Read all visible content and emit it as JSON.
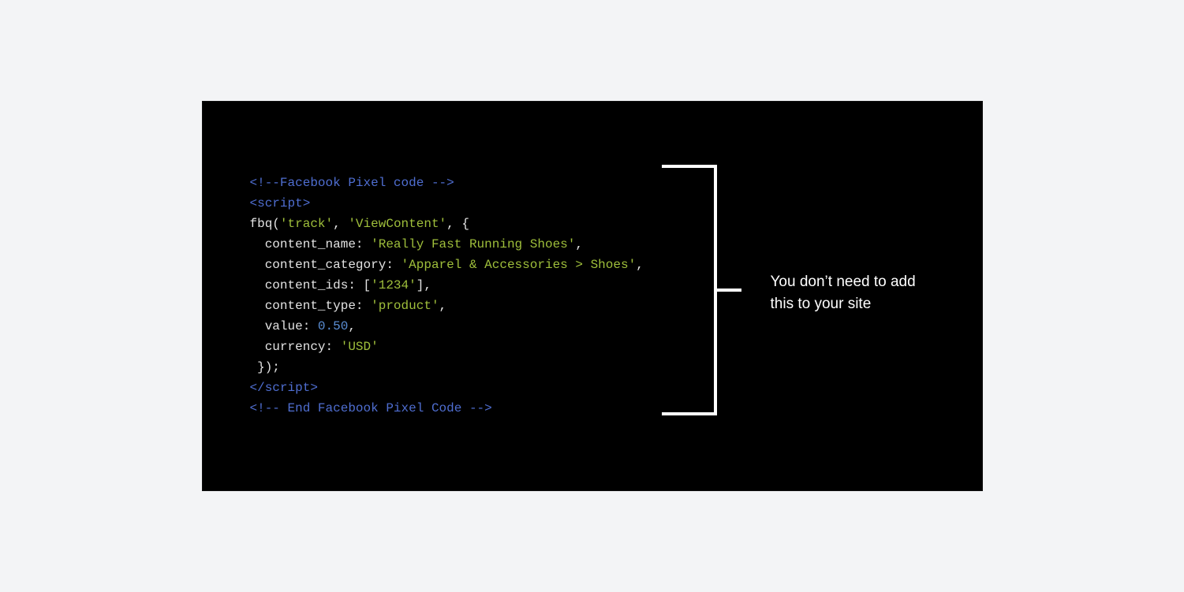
{
  "code": {
    "line1": "<!--Facebook Pixel code -->",
    "line2": "<script>",
    "l3a": "fbq(",
    "l3b": "'track'",
    "l3c": ", ",
    "l3d": "'ViewContent'",
    "l3e": ", {",
    "l4a": "  content_name: ",
    "l4b": "'Really Fast Running Shoes'",
    "l4c": ",",
    "l5a": "  content_category: ",
    "l5b": "'Apparel & Accessories > Shoes'",
    "l5c": ",",
    "l6a": "  content_ids: [",
    "l6b": "'1234'",
    "l6c": "],",
    "l7a": "  content_type: ",
    "l7b": "'product'",
    "l7c": ",",
    "l8a": "  value: ",
    "l8b": "0.50",
    "l8c": ",",
    "l9a": "  currency: ",
    "l9b": "'USD'",
    "l10": " });",
    "line11": "</script>",
    "line12": "<!-- End Facebook Pixel Code -->"
  },
  "annotation": {
    "line1": "You don’t need to add",
    "line2": "this to your site"
  }
}
